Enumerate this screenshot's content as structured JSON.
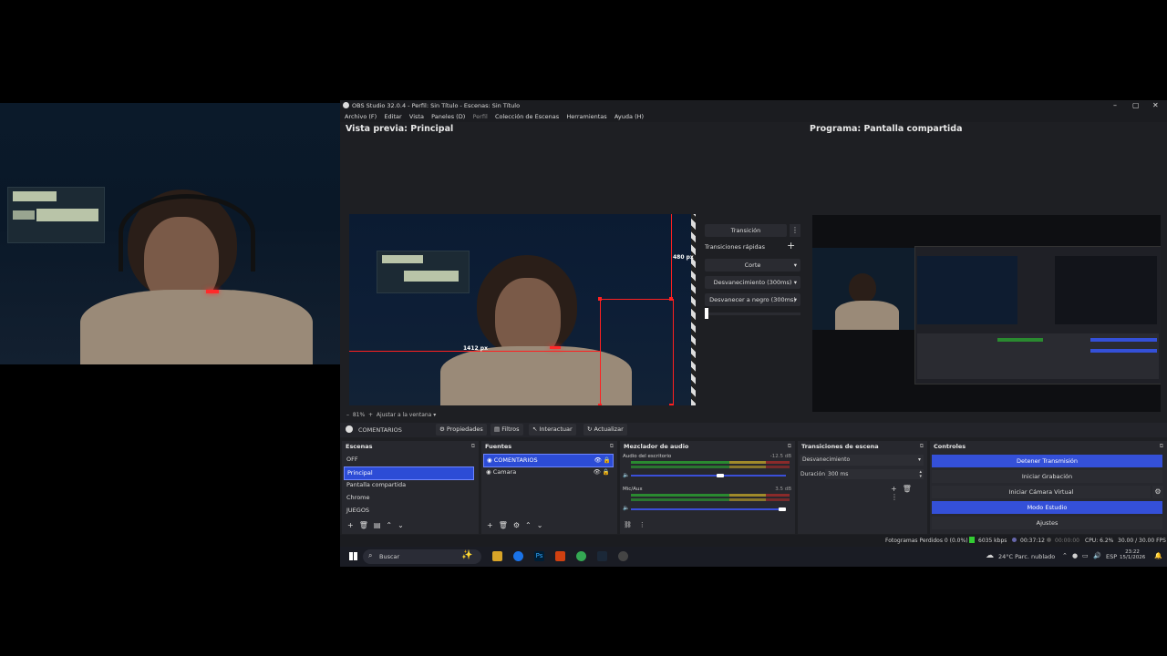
{
  "window": {
    "title": "OBS Studio 32.0.4 - Perfil: Sin Título - Escenas: Sin Título",
    "controls": [
      "–",
      "▢",
      "✕"
    ]
  },
  "menu": [
    "Archivo (F)",
    "Editar",
    "Vista",
    "Paneles (D)",
    "Perfil",
    "Colección de Escenas",
    "Herramientas",
    "Ayuda (H)"
  ],
  "preview": {
    "title": "Vista previa: Principal",
    "width_label": "1412 px",
    "height_label": "480 px",
    "zoom_bar": [
      "–",
      "81%",
      "+",
      "Ajustar a la ventana"
    ]
  },
  "program": {
    "title": "Programa: Pantalla compartida"
  },
  "transitions_mid": {
    "transition_button": "Transición",
    "quick_label": "Transiciones rápidas",
    "items": [
      "Corte",
      "Desvanecimiento (300ms)",
      "Desvanecer a negro (300ms)"
    ]
  },
  "source_toolbar": {
    "source_name": "COMENTARIOS",
    "buttons": [
      "Propiedades",
      "Filtros",
      "Interactuar",
      "Actualizar"
    ]
  },
  "scenes": {
    "title": "Escenas",
    "items": [
      "OFF",
      "Principal",
      "Pantalla compartida",
      "Chrome",
      "JUEGOS"
    ],
    "selected": "Principal"
  },
  "sources": {
    "title": "Fuentes",
    "items": [
      "COMENTARIOS",
      "Camara"
    ],
    "selected": "COMENTARIOS"
  },
  "mixer": {
    "title": "Mezclador de audio",
    "channels": [
      {
        "name": "Audio del escritorio",
        "db": "-12.5 dB",
        "volume": 0.6
      },
      {
        "name": "Mic/Aux",
        "db": "3.5 dB",
        "volume": 1.0
      }
    ],
    "scale": [
      "-60",
      "-55",
      "-50",
      "-45",
      "-40",
      "-35",
      "-30",
      "-25",
      "-20",
      "-15",
      "-10",
      "-5",
      "0"
    ]
  },
  "scene_transitions": {
    "title": "Transiciones de escena",
    "selected": "Desvanecimiento",
    "duration_label": "Duración",
    "duration_value": "300 ms"
  },
  "controls": {
    "title": "Controles",
    "buttons": [
      "Detener Transmisión",
      "Iniciar Grabación",
      "Iniciar Cámara Virtual",
      "Modo Estudio",
      "Ajustes"
    ]
  },
  "status": {
    "dropped": "Fotogramas Perdidos 0 (0.0%)",
    "bitrate": "6035 kbps",
    "live_time": "00:37:12",
    "rec_time": "00:00:00",
    "cpu": "CPU: 6.2%",
    "fps": "30.00 / 30.00 FPS"
  },
  "taskbar": {
    "search_placeholder": "Buscar",
    "weather": "24°C  Parc. nublado",
    "lang": "ESP",
    "time": "23:22",
    "date": "15/1/2026"
  },
  "colors": {
    "accent": "#3450d8",
    "marker_red": "#ff2020"
  }
}
